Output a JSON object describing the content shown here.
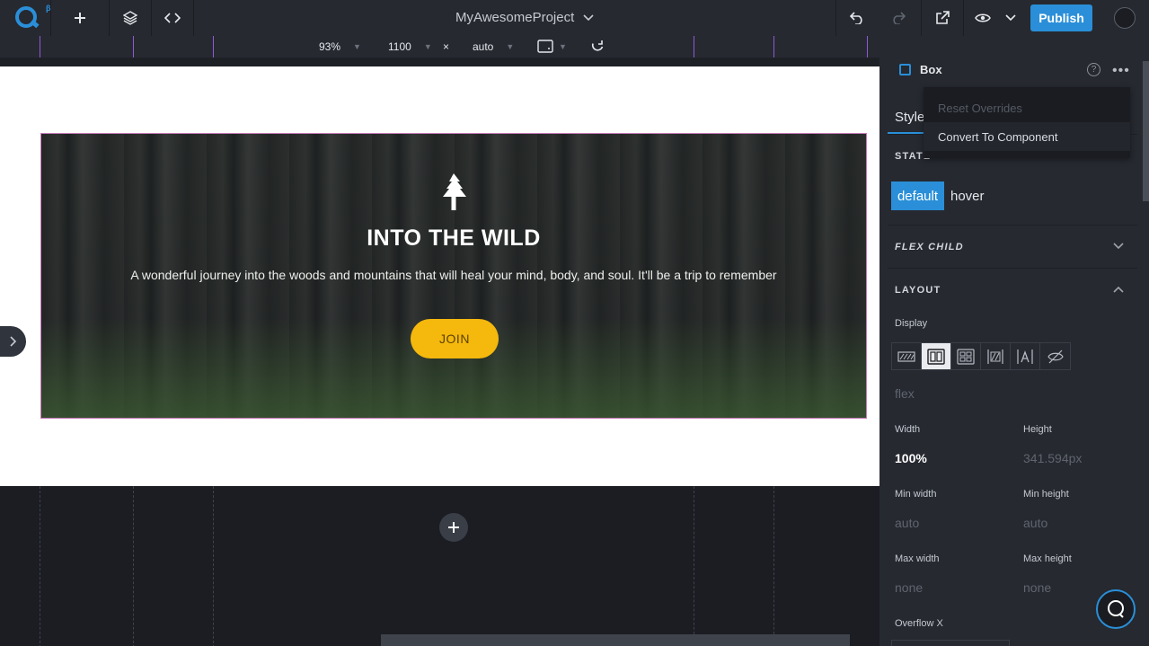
{
  "topbar": {
    "logo_beta": "β",
    "project_title": "MyAwesomeProject",
    "publish_label": "Publish"
  },
  "canvas_toolbar": {
    "zoom": "93%",
    "width": "1100",
    "times": "×",
    "height": "auto"
  },
  "hero": {
    "title": "INTO THE WILD",
    "subtitle": "A wonderful journey into the woods and mountains that will heal your mind, body, and soul. It'll be a trip to remember",
    "button_label": "JOIN"
  },
  "panel": {
    "element_name": "Box",
    "tab_style": "Style",
    "states_label": "STATE",
    "state_default": "default",
    "state_hover": "hover",
    "flex_child_label": "FLEX CHILD",
    "layout_label": "LAYOUT",
    "display_label": "Display",
    "display_value": "flex",
    "width_label": "Width",
    "width_value": "100%",
    "height_label": "Height",
    "height_value": "341.594px",
    "min_width_label": "Min width",
    "min_width_value": "auto",
    "min_height_label": "Min height",
    "min_height_value": "auto",
    "max_width_label": "Max width",
    "max_width_value": "none",
    "max_height_label": "Max height",
    "max_height_value": "none",
    "overflow_x_label": "Overflow X"
  },
  "dropdown": {
    "items": [
      "Reset Overrides",
      "Convert To Component"
    ]
  },
  "colors": {
    "accent": "#2a8fd8",
    "button_yellow": "#f5b80c",
    "selection_outline": "#c87ab8"
  }
}
